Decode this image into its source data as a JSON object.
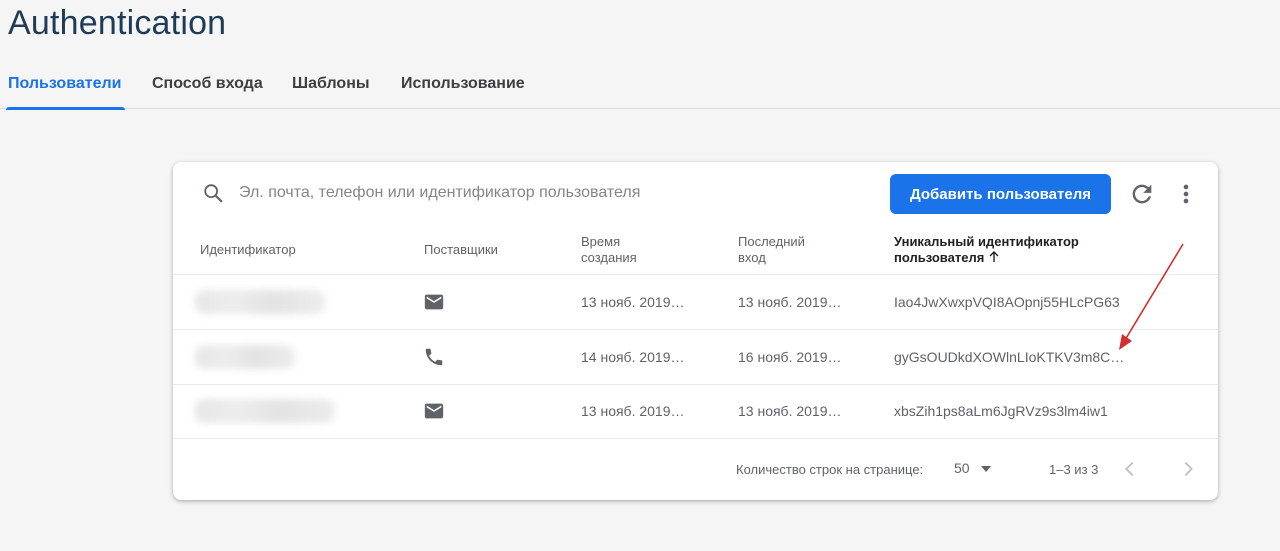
{
  "page": {
    "title": "Authentication"
  },
  "tabs": [
    {
      "label": "Пользователи",
      "active": true
    },
    {
      "label": "Способ входа",
      "active": false
    },
    {
      "label": "Шаблоны",
      "active": false
    },
    {
      "label": "Использование",
      "active": false
    }
  ],
  "toolbar": {
    "search_placeholder": "Эл. почта, телефон или идентификатор пользователя",
    "search_icon": "search-icon",
    "add_user_label": "Добавить пользователя",
    "refresh_icon": "refresh-icon",
    "more_icon": "more-vert-icon"
  },
  "table": {
    "headers": {
      "identifier": "Идентификатор",
      "providers": "Поставщики",
      "created_line1": "Время",
      "created_line2": "создания",
      "last_login_line1": "Последний",
      "last_login_line2": "вход",
      "uid_line1": "Уникальный идентификатор",
      "uid_line2": "пользователя"
    },
    "rows": [
      {
        "identifier": "",
        "provider_icon": "email-icon",
        "created": "13 нояб. 2019…",
        "last_login": "13 нояб. 2019…",
        "uid": "Iao4JwXwxpVQI8AOpnj55HLcPG63"
      },
      {
        "identifier": "",
        "provider_icon": "phone-icon",
        "created": "14 нояб. 2019…",
        "last_login": "16 нояб. 2019…",
        "uid": "gyGsOUDkdXOWlnLIoKTKV3m8C…"
      },
      {
        "identifier": "",
        "provider_icon": "email-icon",
        "created": "13 нояб. 2019…",
        "last_login": "13 нояб. 2019…",
        "uid": "xbsZih1ps8aLm6JgRVz9s3lm4iw1"
      }
    ]
  },
  "pagination": {
    "rows_per_page_label": "Количество строк на странице:",
    "rows_per_page_value": "50",
    "range": "1–3 из 3"
  },
  "colors": {
    "accent": "#1a73e8",
    "title": "#1f3b57",
    "annotation_arrow": "#d32f2f"
  }
}
